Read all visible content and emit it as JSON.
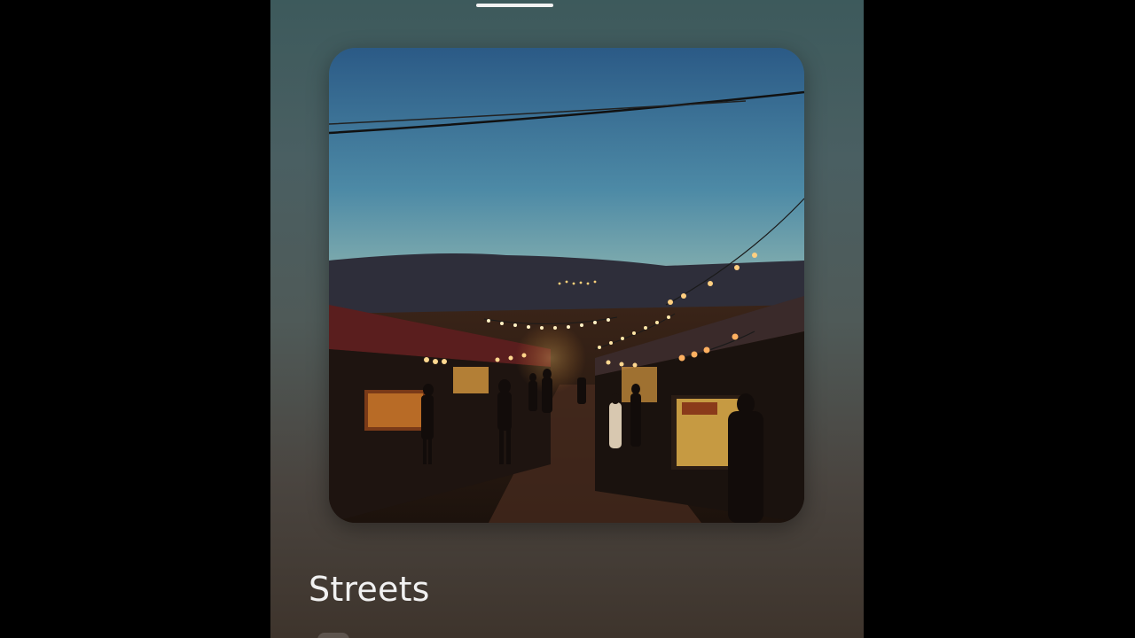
{
  "player": {
    "title": "Streets",
    "subtitle": "",
    "chip_label": ""
  },
  "artwork": {
    "description_icon": "album-artwork"
  },
  "colors": {
    "background_top": "#3d5a5c",
    "background_bottom": "#3e342c",
    "text": "#f1f1f1"
  }
}
